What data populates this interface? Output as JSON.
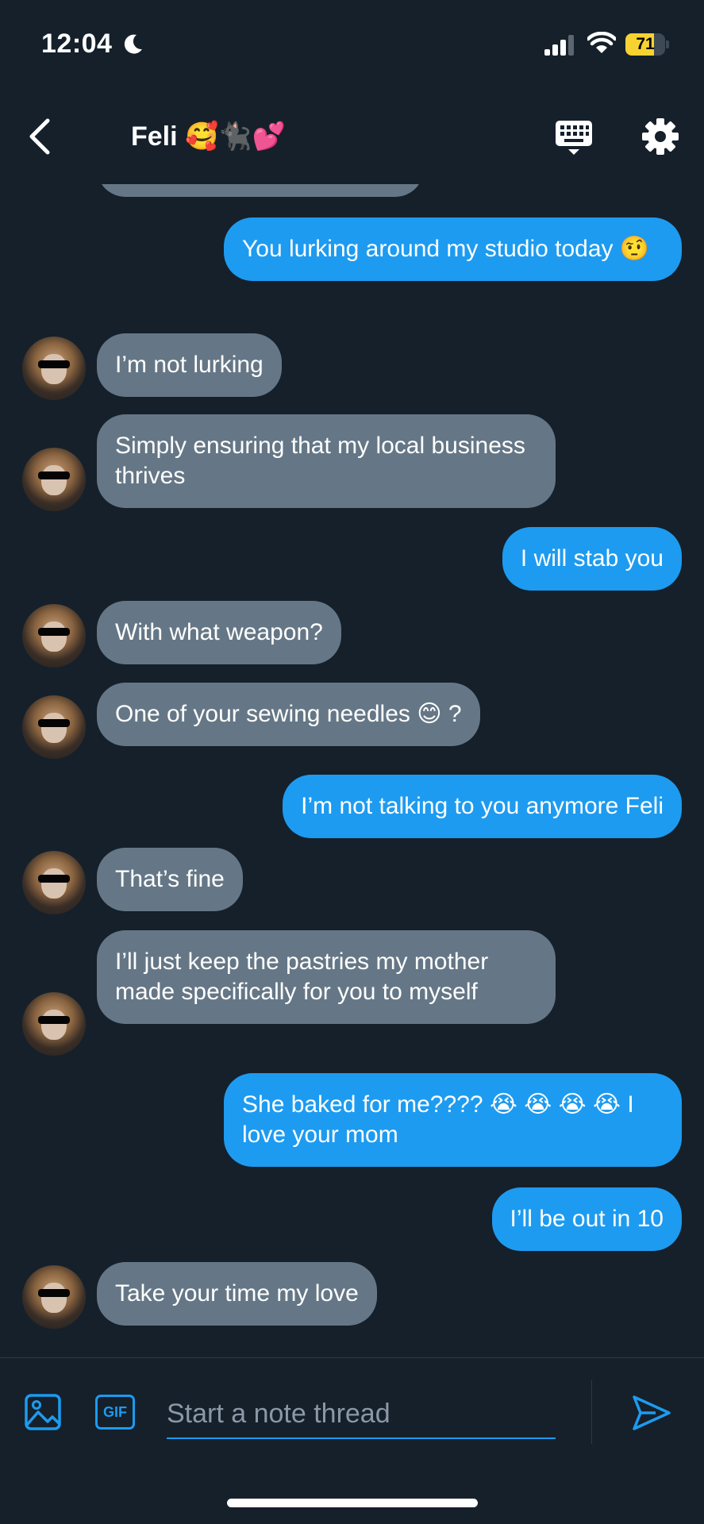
{
  "status_bar": {
    "time": "12:04",
    "battery": "71",
    "battery_level": 0.71
  },
  "header": {
    "contact_name": "Feli 🥰🐈‍⬛💕"
  },
  "messages": [
    {
      "direction": "out",
      "text": " You lurking around my studio today 🤨"
    },
    {
      "direction": "in",
      "text": "I’m not lurking"
    },
    {
      "direction": "in",
      "text": "Simply ensuring that my local business thrives"
    },
    {
      "direction": "out",
      "text": "I will stab you"
    },
    {
      "direction": "in",
      "text": "With what weapon?"
    },
    {
      "direction": "in",
      "text": "One of your sewing needles 😊 ?"
    },
    {
      "direction": "out",
      "text": "I’m not talking to you anymore Feli"
    },
    {
      "direction": "in",
      "text": "That’s fine"
    },
    {
      "direction": "in",
      "text": "I’ll just keep the pastries my mother made specifically for you to myself"
    },
    {
      "direction": "out",
      "text": "She baked for me???? 😭 😭 😭 😭  I love your mom"
    },
    {
      "direction": "out",
      "text": "I’ll be out in 10"
    },
    {
      "direction": "in",
      "text": "Take your time my love"
    }
  ],
  "composer": {
    "placeholder": "Start a note thread",
    "gif_label": "GIF"
  },
  "icons": {
    "back": "chevron-left-icon",
    "keyboard": "keyboard-icon",
    "settings": "gear-icon",
    "image": "image-icon",
    "gif": "gif-icon",
    "send": "send-icon"
  },
  "colors": {
    "background": "#15202b",
    "outgoing": "#1d9bf0",
    "incoming": "#657786",
    "accent": "#1d9bf0"
  }
}
